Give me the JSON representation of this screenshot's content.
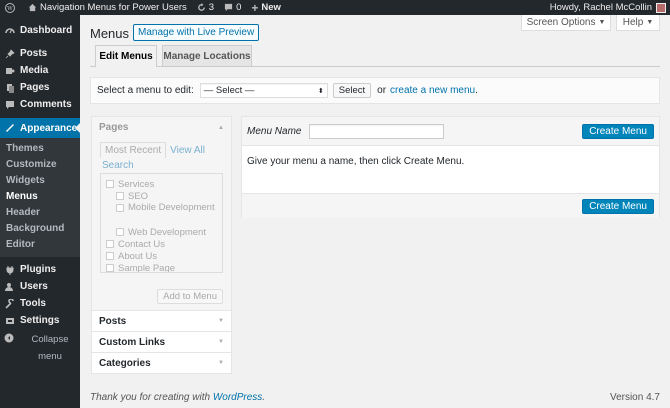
{
  "adminbar": {
    "site_name": "Navigation Menus for Power Users",
    "updates_count": "3",
    "comments_count": "0",
    "new_label": "New",
    "howdy": "Howdy, Rachel McCollin"
  },
  "sidebar": {
    "items": [
      {
        "label": "Dashboard",
        "icon": "dashboard-icon"
      },
      {
        "label": "Posts",
        "icon": "pin-icon"
      },
      {
        "label": "Media",
        "icon": "media-icon"
      },
      {
        "label": "Pages",
        "icon": "pages-icon"
      },
      {
        "label": "Comments",
        "icon": "comment-icon"
      },
      {
        "label": "Appearance",
        "icon": "brush-icon"
      },
      {
        "label": "Plugins",
        "icon": "plugin-icon"
      },
      {
        "label": "Users",
        "icon": "users-icon"
      },
      {
        "label": "Tools",
        "icon": "wrench-icon"
      },
      {
        "label": "Settings",
        "icon": "settings-icon"
      }
    ],
    "appearance_sub": [
      "Themes",
      "Customize",
      "Widgets",
      "Menus",
      "Header",
      "Background",
      "Editor"
    ],
    "collapse_label": "Collapse menu"
  },
  "screen_options": "Screen Options",
  "help": "Help",
  "page_title": "Menus",
  "live_preview": "Manage with Live Preview",
  "tabs": [
    "Edit Menus",
    "Manage Locations"
  ],
  "select_bar": {
    "label": "Select a menu to edit:",
    "select_value": "— Select —",
    "select_button": "Select",
    "or": "or",
    "create_link": "create a new menu",
    "period": "."
  },
  "accordion": {
    "pages_title": "Pages",
    "most_recent": "Most Recent",
    "view_all": "View All",
    "search": "Search",
    "page_items": [
      {
        "label": "Services",
        "level": 0
      },
      {
        "label": "SEO",
        "level": 1
      },
      {
        "label": "Mobile Development",
        "level": 1
      },
      {
        "label": "Web Development",
        "level": 1
      },
      {
        "label": "Contact Us",
        "level": 0
      },
      {
        "label": "About Us",
        "level": 0
      },
      {
        "label": "Sample Page",
        "level": 0
      }
    ],
    "add_to_menu": "Add to Menu",
    "sections": [
      "Posts",
      "Custom Links",
      "Categories"
    ]
  },
  "menu_edit": {
    "name_label": "Menu Name",
    "name_value": "",
    "create_button": "Create Menu",
    "instructions": "Give your menu a name, then click Create Menu."
  },
  "footer": {
    "thanks_prefix": "Thank you for creating with ",
    "wordpress": "WordPress",
    "thanks_suffix": ".",
    "version": "Version 4.7"
  },
  "colors": {
    "adminbar_bg": "#23282d",
    "accent": "#0073aa",
    "primary_button": "#0085ba"
  }
}
